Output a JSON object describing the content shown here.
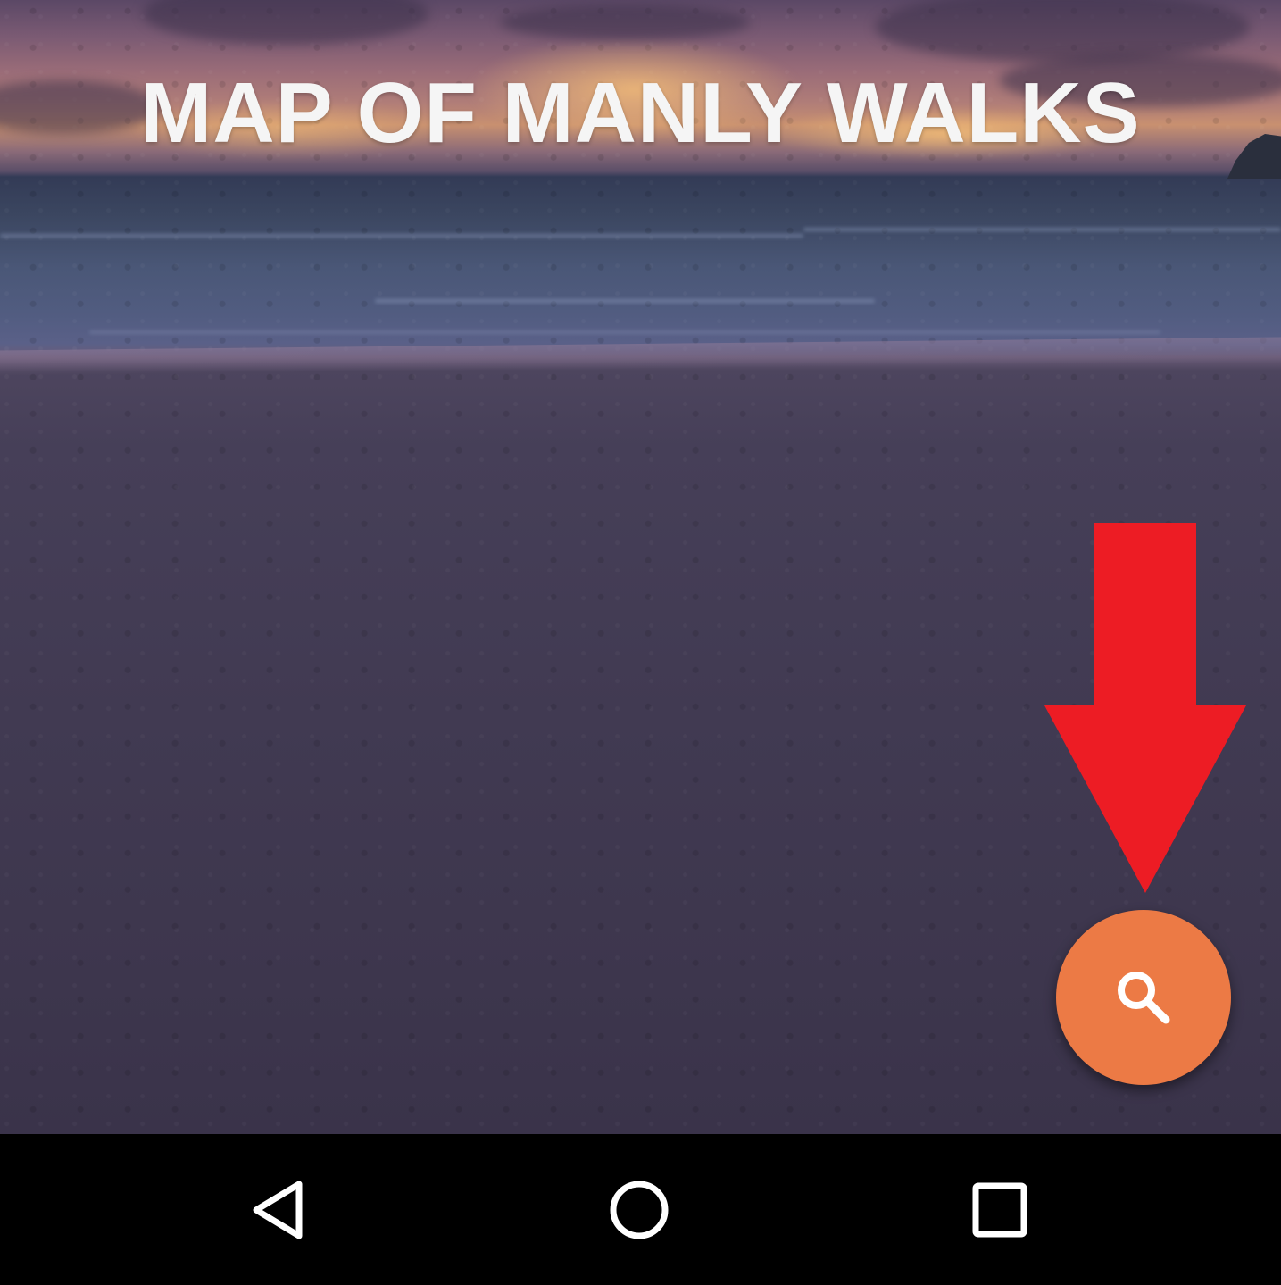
{
  "header": {
    "title": "MAP OF MANLY WALKS"
  },
  "fab": {
    "icon": "search-icon",
    "color": "#ec7a45"
  },
  "annotation": {
    "icon": "down-arrow-icon",
    "color": "#ed1c24"
  },
  "navbar": {
    "back_icon": "back-triangle-icon",
    "home_icon": "home-circle-icon",
    "recents_icon": "recents-square-icon"
  }
}
